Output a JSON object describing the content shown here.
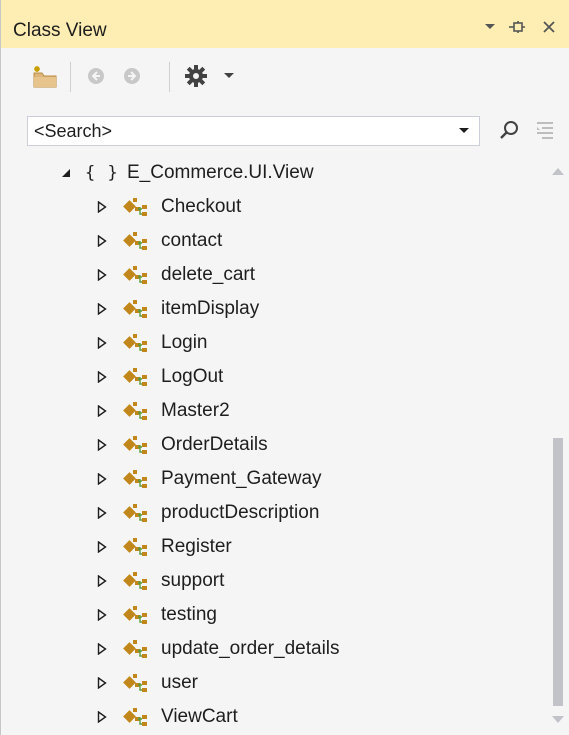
{
  "window": {
    "title": "Class View"
  },
  "title_bar": {
    "icons": [
      "dropdown-arrow-icon",
      "pin-icon",
      "close-icon"
    ]
  },
  "toolbar": {
    "icons": [
      "new-folder-icon",
      "back-icon",
      "forward-icon",
      "settings-gear-icon",
      "chevron-down-icon"
    ]
  },
  "search": {
    "value": "<Search>"
  },
  "tree": {
    "namespace": {
      "icon": "{ }",
      "label": "E_Commerce.UI.View",
      "expanded": true
    },
    "classes": [
      {
        "label": "Checkout"
      },
      {
        "label": "contact"
      },
      {
        "label": "delete_cart"
      },
      {
        "label": "itemDisplay"
      },
      {
        "label": "Login"
      },
      {
        "label": "LogOut"
      },
      {
        "label": "Master2"
      },
      {
        "label": "OrderDetails"
      },
      {
        "label": "Payment_Gateway"
      },
      {
        "label": "productDescription"
      },
      {
        "label": "Register"
      },
      {
        "label": "support"
      },
      {
        "label": "testing"
      },
      {
        "label": "update_order_details"
      },
      {
        "label": "user"
      },
      {
        "label": "ViewCart"
      }
    ]
  },
  "colors": {
    "title_bar_bg": "#ffeeb3",
    "panel_bg": "#f5f5f5",
    "class_icon": "#c2871a",
    "class_icon_accent": "#5b9b3c",
    "scroll_thumb": "#c2c3c9"
  }
}
